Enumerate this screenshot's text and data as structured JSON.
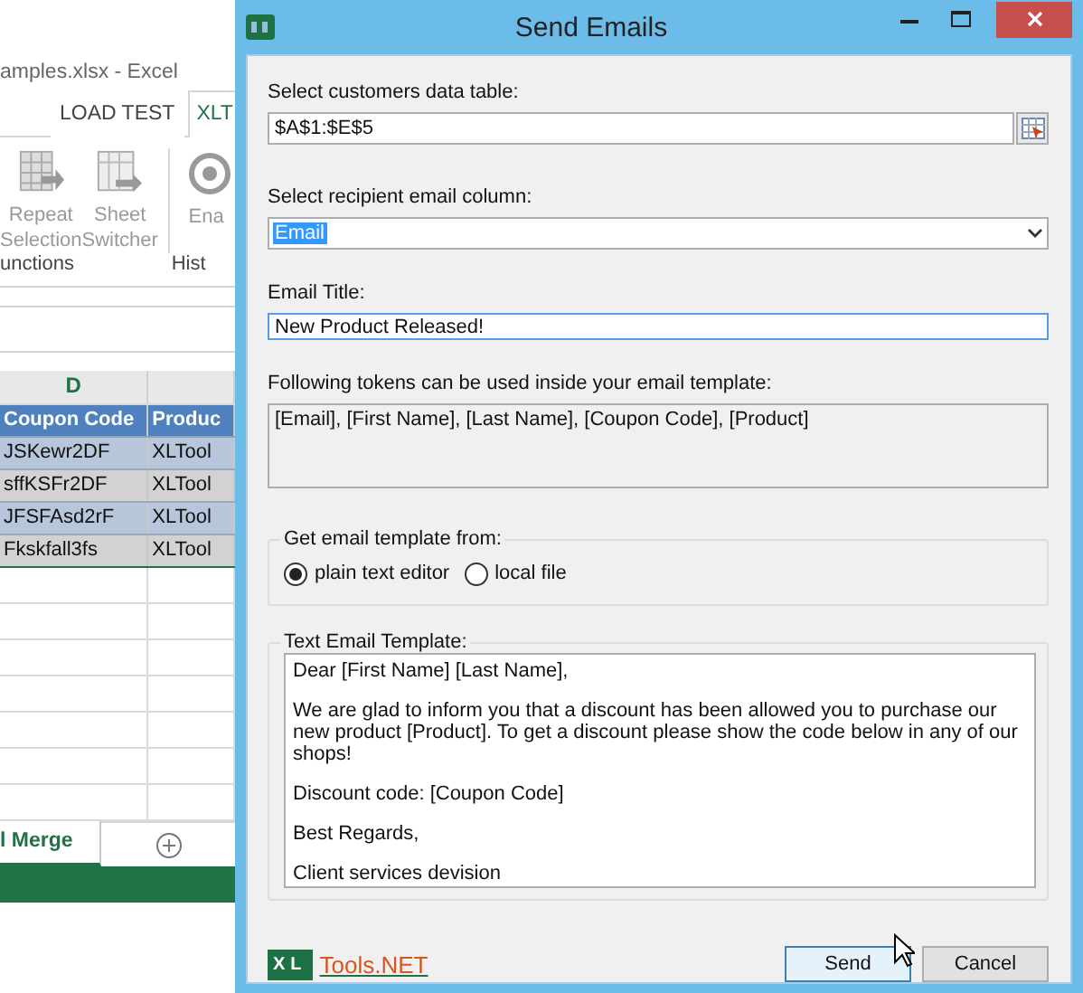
{
  "excel": {
    "title": "amples.xlsx - Excel",
    "ribbon_tabs": [
      {
        "label": "LOAD TEST",
        "selected": false
      },
      {
        "label": "XLT",
        "selected": true
      }
    ],
    "ribbon_buttons": [
      {
        "label": "Repeat\nSelection",
        "kind": "grid"
      },
      {
        "label": "Sheet\nSwitcher",
        "kind": "sheet"
      },
      {
        "label": "Ena",
        "kind": "clock"
      }
    ],
    "ribbon_groups": [
      "unctions",
      "Hist"
    ],
    "column_headers": [
      "D"
    ],
    "table_header": [
      "Coupon Code",
      "Produc"
    ],
    "rows": [
      [
        "JSKewr2DF",
        "XLTool"
      ],
      [
        "sffKSFr2DF",
        "XLTool"
      ],
      [
        "JFSFAsd2rF",
        "XLTool"
      ],
      [
        "Fkskfall3fs",
        "XLTool"
      ]
    ],
    "sheet_tabs": [
      {
        "label": "l Merge",
        "selected": true
      }
    ]
  },
  "dialog": {
    "title": "Send Emails",
    "table_label": "Select customers data table:",
    "table_value": "$A$1:$E$5",
    "column_label": "Select recipient email column:",
    "column_value": "Email",
    "column_text_selected": true,
    "title_label": "Email Title:",
    "title_value": "New Product Released!",
    "tokens_label": "Following tokens can be used inside your email template:",
    "tokens": "[Email], [First Name], [Last Name], [Coupon Code], [Product]",
    "source_label": "Get email template from:",
    "sources": [
      {
        "label": "plain text editor",
        "selected": true
      },
      {
        "label": "local file",
        "selected": false
      }
    ],
    "template_label": "Text Email Template:",
    "template": [
      "Dear [First Name] [Last Name],",
      "We are glad to inform you that a discount has been allowed you to purchase our new product [Product]. To get a discount please show the code below in any of our shops!",
      "Discount code: [Coupon Code]",
      "Best Regards,",
      "Client services devision"
    ],
    "logo": {
      "mark": "XL",
      "wordmark": "Tools.NET"
    },
    "buttons": [
      {
        "label": "Send",
        "focused": true
      },
      {
        "label": "Cancel",
        "focused": false
      }
    ]
  }
}
